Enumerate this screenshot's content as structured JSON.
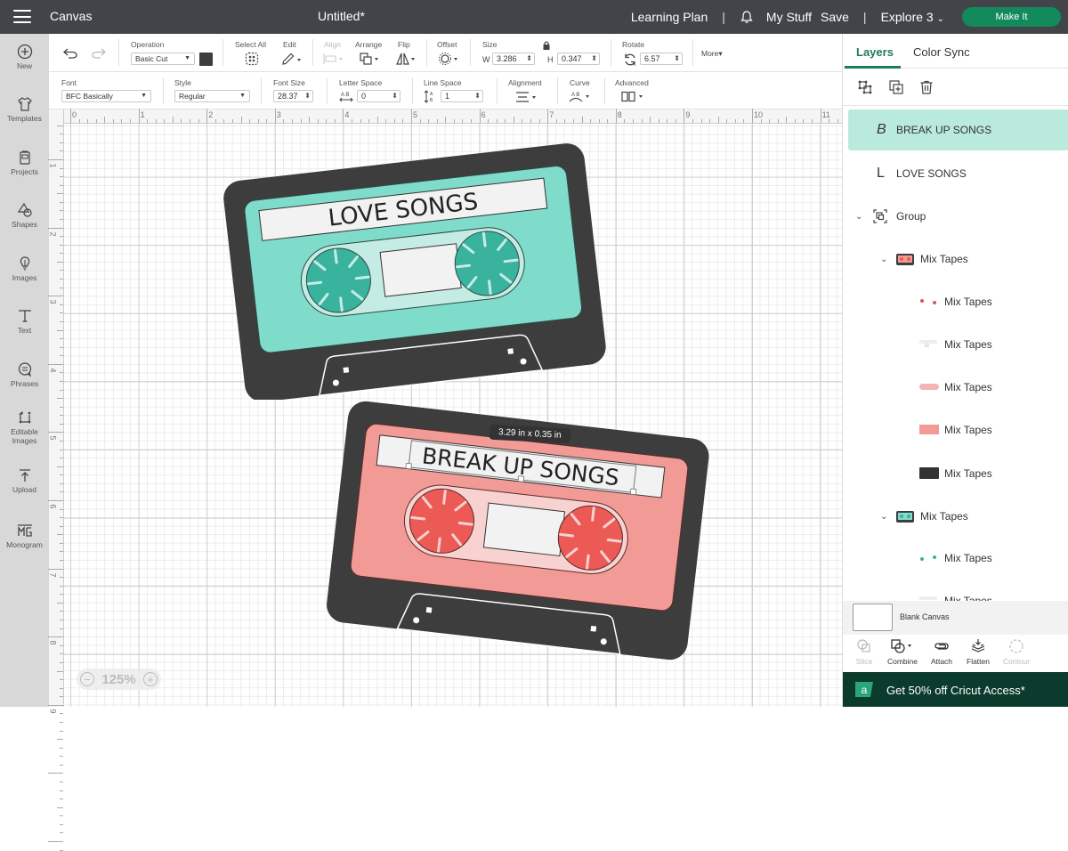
{
  "topbar": {
    "app_title": "Canvas",
    "document_title": "Untitled*",
    "learning_plan": "Learning Plan",
    "my_stuff": "My Stuff",
    "save": "Save",
    "machine": "Explore 3",
    "make_it": "Make It",
    "separator": "|"
  },
  "sidebar": {
    "items": [
      {
        "label": "New",
        "icon": "plus-circle-icon"
      },
      {
        "label": "Templates",
        "icon": "shirt-icon"
      },
      {
        "label": "Projects",
        "icon": "projects-icon"
      },
      {
        "label": "Shapes",
        "icon": "shapes-icon"
      },
      {
        "label": "Images",
        "icon": "lightbulb-icon"
      },
      {
        "label": "Text",
        "icon": "text-icon"
      },
      {
        "label": "Phrases",
        "icon": "speech-bubble-icon"
      },
      {
        "label": "Editable",
        "label2": "Images",
        "icon": "editable-images-icon"
      },
      {
        "label": "Upload",
        "icon": "upload-icon"
      },
      {
        "label": "Monogram",
        "icon": "monogram-icon"
      }
    ]
  },
  "toolbar1": {
    "operation_label": "Operation",
    "operation_value": "Basic Cut",
    "operation_color": "#3d3d3d",
    "select_all": "Select All",
    "edit": "Edit",
    "align": "Align",
    "arrange": "Arrange",
    "flip": "Flip",
    "offset": "Offset",
    "size_label": "Size",
    "w_label": "W",
    "w_value": "3.286",
    "h_label": "H",
    "h_value": "0.347",
    "rotate_label": "Rotate",
    "rotate_value": "6.57",
    "more": "More▾"
  },
  "toolbar2": {
    "font_label": "Font",
    "font_value": "BFC Basically",
    "style_label": "Style",
    "style_value": "Regular",
    "font_size_label": "Font Size",
    "font_size_value": "28.37",
    "letter_space_label": "Letter Space",
    "letter_space_value": "0",
    "line_space_label": "Line Space",
    "line_space_value": "1",
    "alignment_label": "Alignment",
    "curve_label": "Curve",
    "advanced_label": "Advanced"
  },
  "rulers": {
    "top": [
      "0",
      "1",
      "2",
      "3",
      "4",
      "5",
      "6",
      "7",
      "8",
      "9",
      "10",
      "11"
    ],
    "left": [
      "1",
      "2",
      "3",
      "4",
      "5",
      "6",
      "7",
      "8",
      "9"
    ]
  },
  "canvas": {
    "tape1": {
      "label": "LOVE SONGS",
      "body_color": "#3d3d3d",
      "face_color": "#7fdccb",
      "reel_color": "#3ab39e",
      "window_color": "#c5ece4"
    },
    "tape2": {
      "label": "BREAK UP SONGS",
      "body_color": "#3d3d3d",
      "face_color": "#f29a95",
      "reel_color": "#ec5a55",
      "window_color": "#f8d2d0"
    },
    "dimension_tag": "3.29  in x 0.35  in",
    "zoom": "125%"
  },
  "panel": {
    "tabs": [
      "Layers",
      "Color Sync"
    ],
    "active_tab": "Layers",
    "layers": [
      {
        "glyph": "B",
        "name": "BREAK UP SONGS",
        "selected": true
      },
      {
        "glyph": "L",
        "name": "LOVE SONGS"
      },
      {
        "name": "Group",
        "expanded": true
      },
      {
        "name": "Mix Tapes",
        "expanded": true,
        "thumb": "red-tape"
      },
      {
        "name": "Mix Tapes",
        "thumb": "red-dots"
      },
      {
        "name": "Mix Tapes",
        "thumb": "white-label"
      },
      {
        "name": "Mix Tapes",
        "thumb": "pink-window"
      },
      {
        "name": "Mix Tapes",
        "thumb": "salmon-face"
      },
      {
        "name": "Mix Tapes",
        "thumb": "dark-body"
      },
      {
        "name": "Mix Tapes",
        "expanded": true,
        "thumb": "teal-tape"
      },
      {
        "name": "Mix Tapes",
        "thumb": "teal-dots"
      },
      {
        "name": "Mix Tapes",
        "thumb": "white-label"
      }
    ],
    "blank_canvas": "Blank Canvas",
    "ops": [
      "Slice",
      "Combine",
      "Attach",
      "Flatten",
      "Contour"
    ],
    "promo": "Get 50% off Cricut Access*",
    "promo_badge": "a"
  },
  "colors": {
    "accent": "#1f7a5a",
    "make_it": "#138a5c",
    "topbar": "#414549",
    "selected_layer": "#b9eadb",
    "promo_bg": "#0b3b2c"
  }
}
